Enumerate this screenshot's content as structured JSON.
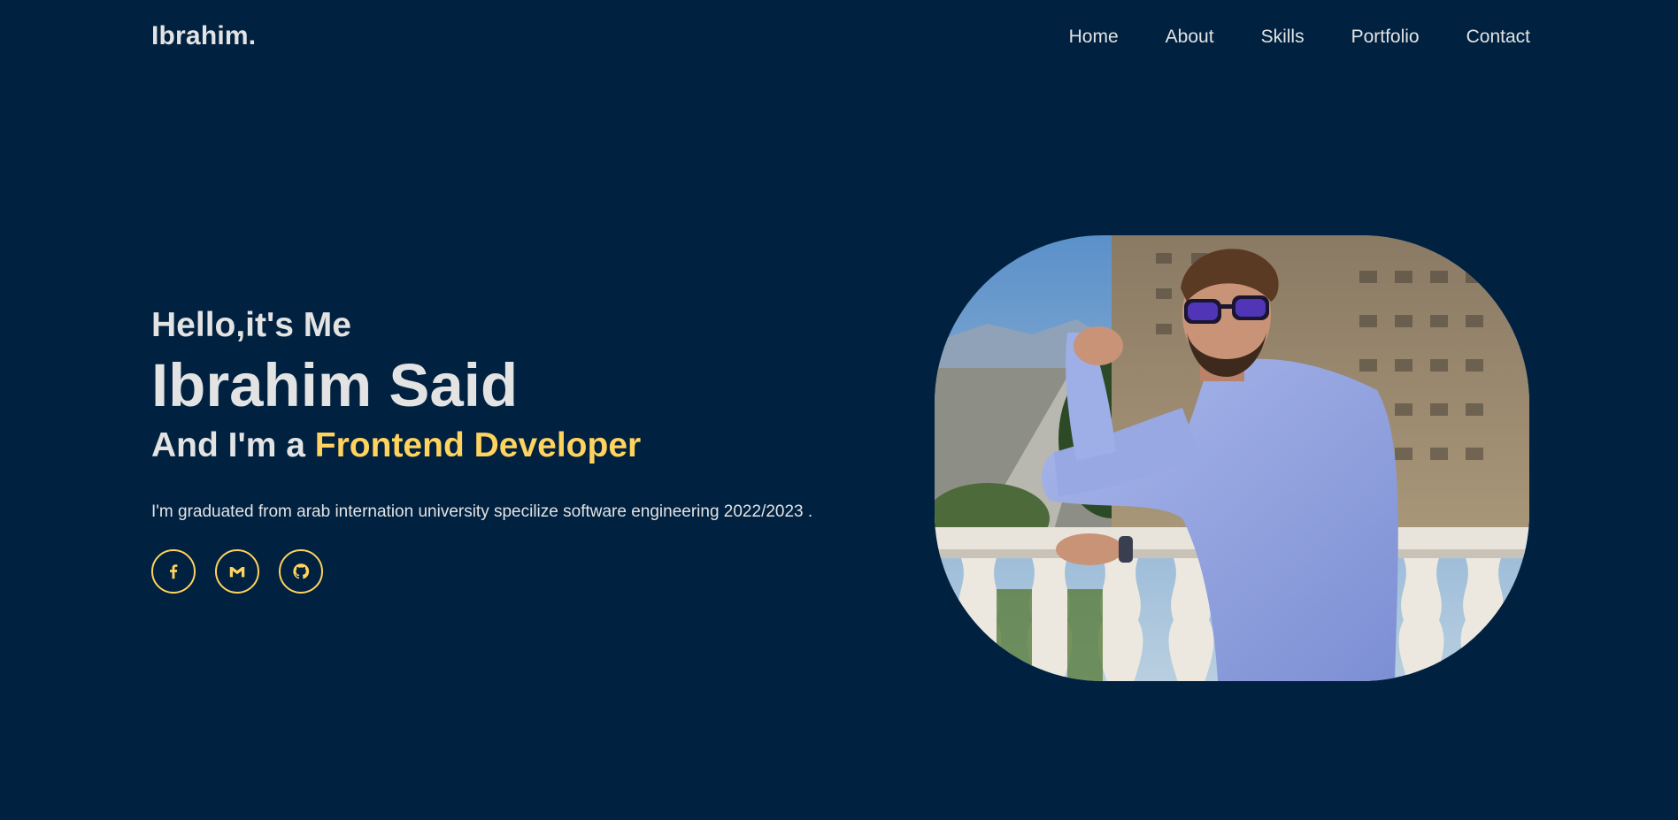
{
  "header": {
    "logo": "Ibrahim.",
    "nav": [
      "Home",
      "About",
      "Skills",
      "Portfolio",
      "Contact"
    ]
  },
  "hero": {
    "greeting": "Hello,it's Me",
    "name": "Ibrahim Said",
    "role_prefix": "And I'm a ",
    "role_highlight": "Frontend Developer",
    "bio": "I'm graduated from arab internation university specilize software engineering 2022/2023 ."
  },
  "socials": [
    {
      "icon": "facebook-icon"
    },
    {
      "icon": "gmail-icon"
    },
    {
      "icon": "github-icon"
    }
  ],
  "photo": {
    "subject": "profile-photo"
  },
  "colors": {
    "background": "#002140",
    "text": "#e3e3e3",
    "accent": "#ffd35d"
  }
}
